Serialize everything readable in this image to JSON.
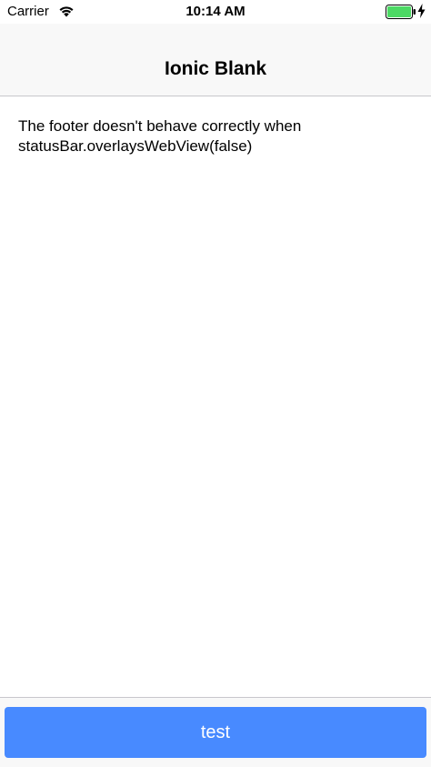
{
  "status_bar": {
    "carrier": "Carrier",
    "time": "10:14 AM",
    "battery_color": "#4cd964",
    "icons": [
      "wifi-icon",
      "battery-icon",
      "charging-bolt-icon"
    ]
  },
  "header": {
    "title": "Ionic Blank",
    "background": "#f8f8f8"
  },
  "content": {
    "message_line1": "The footer doesn't behave correctly when",
    "message_line2": "statusBar.overlaysWebView(false)"
  },
  "footer": {
    "button_label": "test",
    "button_color": "#488aff"
  }
}
